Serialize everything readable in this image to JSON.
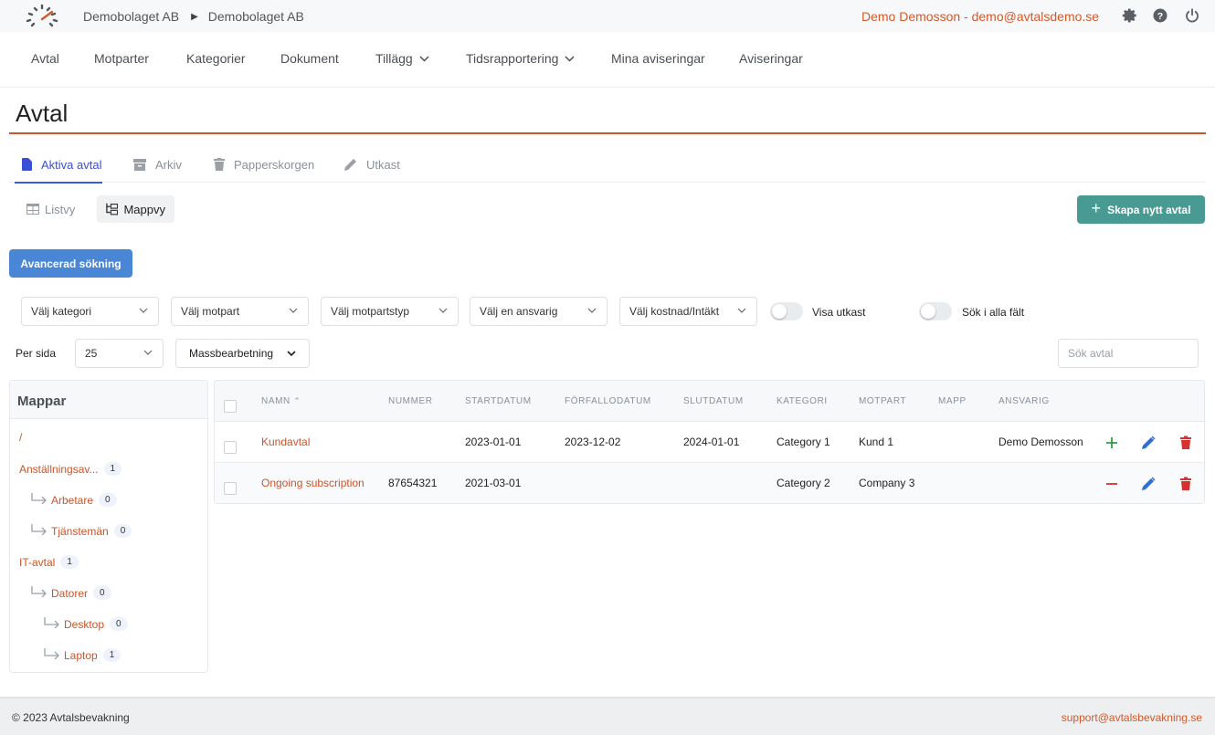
{
  "header": {
    "breadcrumb": [
      "Demobolaget AB",
      "Demobolaget AB"
    ],
    "user": "Demo Demosson - demo@avtalsdemo.se",
    "icons": [
      "gear-icon",
      "help-icon",
      "power-icon"
    ]
  },
  "nav": {
    "items": [
      "Avtal",
      "Motparter",
      "Kategorier",
      "Dokument",
      "Tillägg",
      "Tidsrapportering",
      "Mina aviseringar",
      "Aviseringar"
    ]
  },
  "page": {
    "title": "Avtal"
  },
  "tabs": [
    "Aktiva avtal",
    "Arkiv",
    "Papperskorgen",
    "Utkast"
  ],
  "views": {
    "list": "Listvy",
    "folder": "Mappvy"
  },
  "buttons": {
    "create": "Skapa nytt avtal",
    "advanced": "Avancerad sökning",
    "mass": "Massbearbetning"
  },
  "filters": {
    "category": "Välj kategori",
    "party": "Välj motpart",
    "party_type": "Välj motpartstyp",
    "responsible": "Välj en ansvarig",
    "cost": "Välj kostnad/Intäkt",
    "show_drafts": "Visa utkast",
    "search_all": "Sök i alla fält"
  },
  "paging": {
    "label": "Per sida",
    "value": "25"
  },
  "search": {
    "placeholder": "Sök avtal"
  },
  "folders": {
    "title": "Mappar",
    "root": "/",
    "items": [
      {
        "name": "Anställningsav...",
        "count": "1"
      },
      {
        "name": "Arbetare",
        "count": "0"
      },
      {
        "name": "Tjänstemän",
        "count": "0"
      },
      {
        "name": "IT-avtal",
        "count": "1"
      },
      {
        "name": "Datorer",
        "count": "0"
      },
      {
        "name": "Desktop",
        "count": "0"
      },
      {
        "name": "Laptop",
        "count": "1"
      }
    ]
  },
  "table": {
    "columns": [
      "NAMN",
      "NUMMER",
      "STARTDATUM",
      "FÖRFALLODATUM",
      "SLUTDATUM",
      "KATEGORI",
      "MOTPART",
      "MAPP",
      "ANSVARIG"
    ],
    "rows": [
      {
        "name": "Kundavtal",
        "number": "",
        "start": "2023-01-01",
        "due": "2023-12-02",
        "end": "2024-01-01",
        "category": "Category 1",
        "party": "Kund 1",
        "folder": "",
        "responsible": "Demo Demosson"
      },
      {
        "name": "Ongoing subscription",
        "number": "87654321",
        "start": "2021-03-01",
        "due": "",
        "end": "",
        "category": "Category 2",
        "party": "Company 3",
        "folder": "",
        "responsible": ""
      }
    ]
  },
  "footer": {
    "copyright": "© 2023 Avtalsbevakning",
    "email": "support@avtalsbevakning.se"
  },
  "colors": {
    "accent": "#c9552d",
    "primary": "#4a86d6",
    "create": "#4a9a94",
    "tab_active": "#3b5bdb"
  }
}
